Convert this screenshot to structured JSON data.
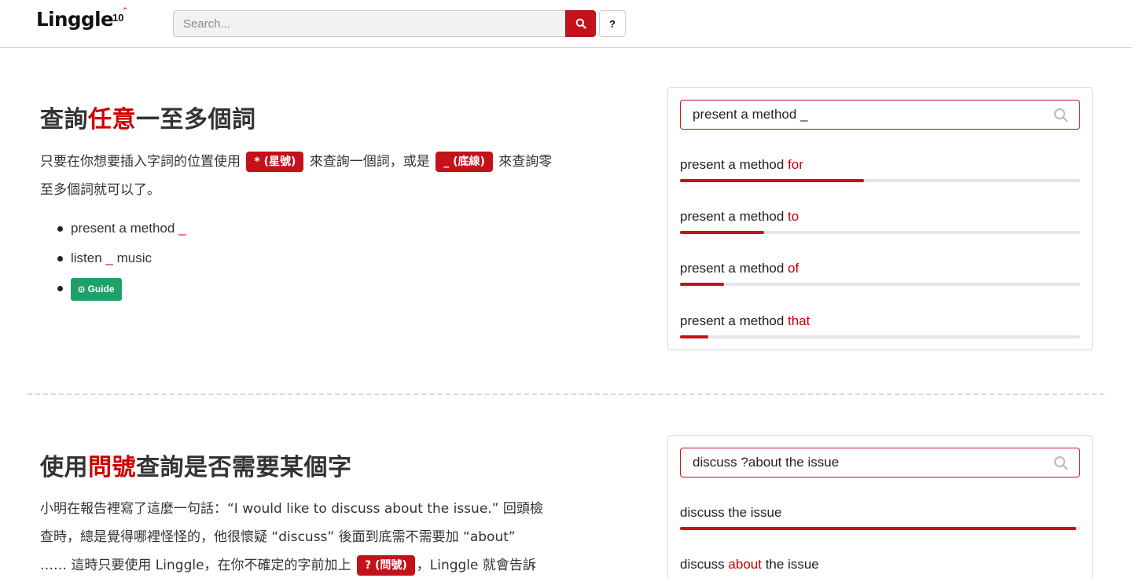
{
  "header": {
    "logo_text": "Linggle",
    "logo_version": "10",
    "search_placeholder": "Search...",
    "help_label": "?"
  },
  "section1": {
    "heading_pre": "查詢",
    "heading_highlight": "任意",
    "heading_post": "一至多個詞",
    "para_part1": "只要在你想要插入字詞的位置使用",
    "badge_star": "* (星號)",
    "para_part2": "來查詢一個詞，或是",
    "badge_underscore": "_ (底線)",
    "para_part3": "來查詢零至多個詞就可以了。",
    "examples": [
      {
        "pre": "present a method ",
        "mark": "_",
        "post": ""
      },
      {
        "pre": "listen ",
        "mark": "_",
        "post": " music"
      }
    ],
    "guide_label": "Guide"
  },
  "panel1": {
    "query": "present a method _",
    "results": [
      {
        "base": "present a method ",
        "word": "for",
        "ratio": 0.46
      },
      {
        "base": "present a method ",
        "word": "to",
        "ratio": 0.21
      },
      {
        "base": "present a method ",
        "word": "of",
        "ratio": 0.11
      },
      {
        "base": "present a method ",
        "word": "that",
        "ratio": 0.07
      }
    ]
  },
  "section2": {
    "heading_pre": "使用",
    "heading_highlight": "問號",
    "heading_post": "查詢是否需要某個字",
    "para_line1": "小明在報告裡寫了這麼一句話：“I would like to discuss about the issue.” 回頭檢",
    "para_line2": "查時，總是覺得哪裡怪怪的，他很懷疑 “discuss” 後面到底需不需要加 “about”",
    "para_line3_pre": "…… 這時只要使用 Linggle，在你不確定的字前加上",
    "badge_question": "? (問號)",
    "para_line3_post": "，Linggle 就會告訴"
  },
  "panel2": {
    "query": "discuss ?about the issue",
    "results": [
      {
        "pre": "discuss the issue",
        "word": "",
        "post": "",
        "ratio": 0.99
      },
      {
        "pre": "discuss ",
        "word": "about",
        "post": " the issue",
        "ratio": 0.02
      }
    ]
  },
  "colors": {
    "accent": "#c4111a",
    "guide": "#1fa06b"
  }
}
